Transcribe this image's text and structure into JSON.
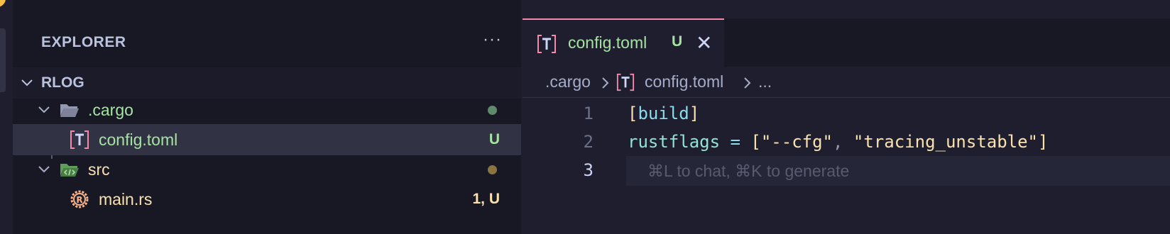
{
  "window": {
    "traffic_lights": [
      "yellow",
      "green"
    ]
  },
  "sidebar": {
    "title": "EXPLORER",
    "more_label": "···",
    "root": {
      "label": "RLOG",
      "expanded": true
    },
    "tree": [
      {
        "label": ".cargo",
        "type": "folder",
        "expanded": true,
        "status_kind": "dot",
        "status_color": "#5f8a6b",
        "label_color": "#a6e3a1",
        "icon": "folder-open-icon"
      },
      {
        "label": "config.toml",
        "type": "file",
        "status": "U",
        "status_color": "#a6e3a1",
        "label_color": "#a6e3a1",
        "icon": "toml-file-icon",
        "active": true
      },
      {
        "label": "src",
        "type": "folder",
        "expanded": true,
        "status_kind": "dot",
        "status_color": "#8a7440",
        "label_color": "#f9e2af",
        "icon": "folder-src-icon"
      },
      {
        "label": "main.rs",
        "type": "file",
        "status": "1, U",
        "status_color": "#f9e2af",
        "label_color": "#f9e2af",
        "icon": "rust-file-icon"
      }
    ]
  },
  "editor": {
    "tab": {
      "label": "config.toml",
      "status": "U",
      "close": "✕"
    },
    "breadcrumb": {
      "segments": [
        ".cargo",
        "config.toml",
        "..."
      ]
    },
    "lines": [
      {
        "number": "1",
        "tokens": [
          {
            "t": "[",
            "c": "c-bracket"
          },
          {
            "t": "build",
            "c": "c-section"
          },
          {
            "t": "]",
            "c": "c-bracket"
          }
        ]
      },
      {
        "number": "2",
        "tokens": [
          {
            "t": "rustflags",
            "c": "c-key"
          },
          {
            "t": " = ",
            "c": "c-op"
          },
          {
            "t": "[",
            "c": "c-bracket"
          },
          {
            "t": "\"--cfg\"",
            "c": "c-str"
          },
          {
            "t": ", ",
            "c": "c-punct"
          },
          {
            "t": "\"tracing_unstable\"",
            "c": "c-str"
          },
          {
            "t": "]",
            "c": "c-bracket"
          }
        ]
      },
      {
        "number": "3",
        "tokens": [],
        "current": true
      }
    ],
    "inline_hint": "⌘L to chat, ⌘K to generate"
  },
  "colors": {
    "accent_tab_border": "#f38ba8",
    "background": "#1e1e2e",
    "sidebar_bg": "#181825"
  }
}
